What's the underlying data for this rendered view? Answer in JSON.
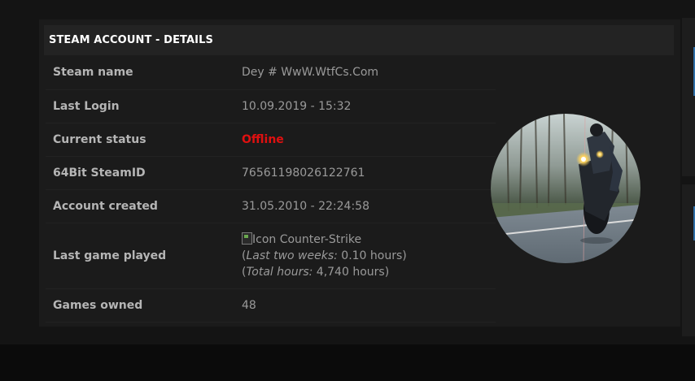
{
  "panel": {
    "title": "STEAM ACCOUNT - DETAILS"
  },
  "details": {
    "steam_name_label": "Steam name",
    "steam_name_value": "Dey # WwW.WtfCs.Com",
    "last_login_label": "Last Login",
    "last_login_value": "10.09.2019 - 15:32",
    "current_status_label": "Current status",
    "current_status_value": "Offline",
    "steamid_label": "64Bit SteamID",
    "steamid_value": "76561198026122761",
    "account_created_label": "Account created",
    "account_created_value": "31.05.2010 - 22:24:58",
    "last_game_label": "Last game played",
    "last_game_icon_alt": "Icon",
    "last_game_name": "Counter-Strike",
    "last_two_weeks_label": "Last two weeks:",
    "last_two_weeks_value": "0.10 hours",
    "total_hours_label": "Total hours:",
    "total_hours_value": "4,740 hours",
    "games_owned_label": "Games owned",
    "games_owned_value": "48"
  },
  "colors": {
    "status_offline": "#e01010",
    "accent_blue": "#2e6ea6"
  }
}
